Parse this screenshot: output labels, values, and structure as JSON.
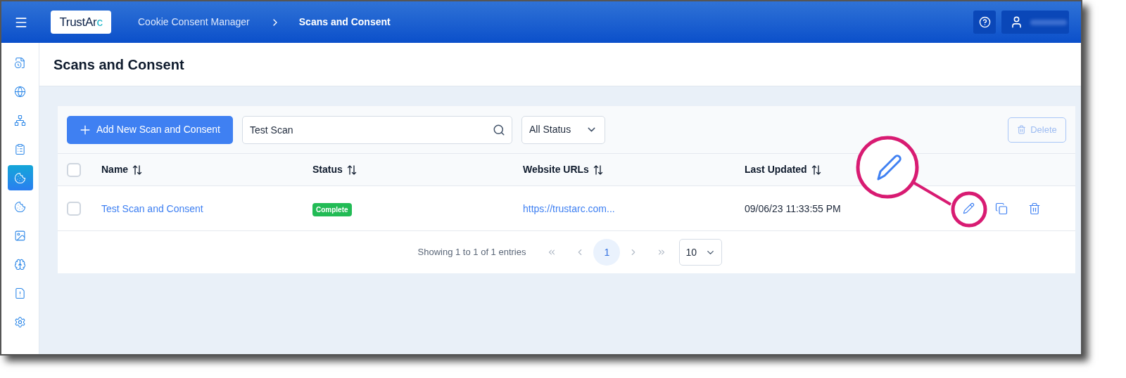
{
  "header": {
    "logo": {
      "text": "TrustAr",
      "accent": "c"
    },
    "breadcrumb": [
      "Cookie Consent Manager",
      "Scans and Consent"
    ]
  },
  "sidebar": {
    "items": [
      {
        "selected": false
      },
      {
        "selected": false
      },
      {
        "selected": false
      },
      {
        "selected": false
      },
      {
        "selected": true
      },
      {
        "selected": false
      },
      {
        "selected": false
      },
      {
        "selected": false
      },
      {
        "selected": false
      },
      {
        "selected": false
      }
    ]
  },
  "page_title": "Scans and Consent",
  "toolbar": {
    "add_button": "Add New Scan and Consent",
    "search": {
      "value": "Test Scan"
    },
    "status_filter": "All Status",
    "delete_button": {
      "label": "Delete",
      "disabled": true
    }
  },
  "table": {
    "select_all": {
      "checked": false
    },
    "columns": [
      {
        "label": "Name"
      },
      {
        "label": "Status"
      },
      {
        "label": "Website URLs"
      },
      {
        "label": "Last Updated"
      }
    ],
    "rows": [
      {
        "checked": false,
        "name": "Test Scan and Consent",
        "status": "Complete",
        "url": "https://trustarc.com...",
        "last_updated": "09/06/23 11:33:55 PM"
      }
    ]
  },
  "pagination": {
    "summary": "Showing 1 to 1 of 1 entries",
    "pages": [
      {
        "label": "1",
        "selected": true
      }
    ],
    "page_size": "10"
  }
}
